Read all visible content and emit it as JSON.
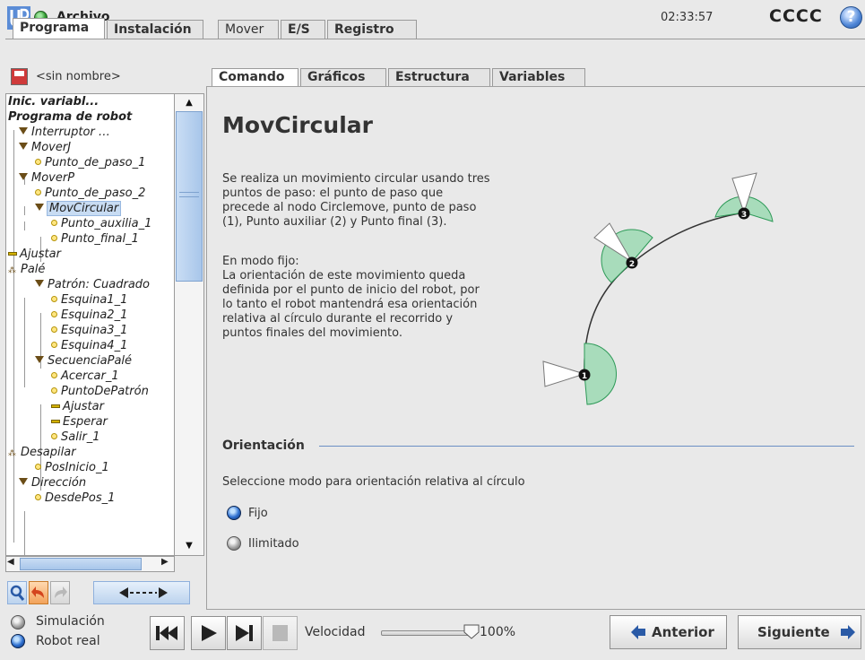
{
  "header": {
    "file_menu": "Archivo",
    "clock": "02:33:57",
    "robot_name": "CCCC",
    "help_glyph": "?"
  },
  "main_tabs": [
    "Programa",
    "Instalación",
    "Mover",
    "E/S",
    "Registro"
  ],
  "program": {
    "name": "<sin nombre>",
    "tree": [
      {
        "label": "Inic. variabl...",
        "kind": "text",
        "bold": true
      },
      {
        "label": "Programa de robot",
        "kind": "text",
        "bold": true
      },
      {
        "label": "Interruptor …",
        "kind": "block"
      },
      {
        "label": "MoverJ",
        "kind": "block"
      },
      {
        "label": "Punto_de_paso_1",
        "kind": "waypoint"
      },
      {
        "label": "MoverP",
        "kind": "block"
      },
      {
        "label": "Punto_de_paso_2",
        "kind": "waypoint"
      },
      {
        "label": "MovCircular",
        "kind": "block",
        "selected": true
      },
      {
        "label": "Punto_auxilia_1",
        "kind": "waypoint"
      },
      {
        "label": "Punto_final_1",
        "kind": "waypoint"
      },
      {
        "label": "Ajustar",
        "kind": "bar"
      },
      {
        "label": "Palé",
        "kind": "pallet"
      },
      {
        "label": "Patrón: Cuadrado",
        "kind": "block"
      },
      {
        "label": "Esquina1_1",
        "kind": "waypoint"
      },
      {
        "label": "Esquina2_1",
        "kind": "waypoint"
      },
      {
        "label": "Esquina3_1",
        "kind": "waypoint"
      },
      {
        "label": "Esquina4_1",
        "kind": "waypoint"
      },
      {
        "label": "SecuenciaPalé",
        "kind": "block"
      },
      {
        "label": "Acercar_1",
        "kind": "waypoint"
      },
      {
        "label": "PuntoDePatrón",
        "kind": "waypoint"
      },
      {
        "label": "Ajustar",
        "kind": "bar"
      },
      {
        "label": "Esperar",
        "kind": "bar"
      },
      {
        "label": "Salir_1",
        "kind": "waypoint"
      },
      {
        "label": "Desapilar",
        "kind": "pallet"
      },
      {
        "label": "PosInicio_1",
        "kind": "waypoint"
      },
      {
        "label": "Dirección",
        "kind": "block"
      },
      {
        "label": "DesdePos_1",
        "kind": "waypoint"
      }
    ]
  },
  "sub_tabs": [
    "Comando",
    "Gráficos",
    "Estructura",
    "Variables"
  ],
  "command": {
    "title": "MovCircular",
    "description_1": "Se realiza un movimiento circular usando tres\npuntos de paso: el punto de paso que\nprecede al nodo Circlemove, punto de paso\n(1), Punto auxiliar (2) y Punto final (3).",
    "description_2": "En modo fijo:\nLa orientación de este movimiento queda\ndefinida por el punto de inicio del robot, por\nlo tanto el robot mantendrá esa orientación\nrelativa al círculo durante el recorrido y\npuntos finales del movimiento.",
    "diagram_points": [
      "1",
      "2",
      "3"
    ],
    "orientation_heading": "Orientación",
    "orientation_instruction": "Seleccione modo para orientación relativa al círculo",
    "orientation_options": [
      {
        "label": "Fijo",
        "selected": true
      },
      {
        "label": "Ilimitado",
        "selected": false
      }
    ]
  },
  "footer": {
    "modes": [
      {
        "label": "Simulación",
        "selected": false
      },
      {
        "label": "Robot real",
        "selected": true
      }
    ],
    "speed_label": "Velocidad",
    "speed_value": "100%",
    "speed_fraction": 1.0,
    "prev_label": "Anterior",
    "next_label": "Siguiente"
  },
  "colors": {
    "accent": "#6b8fc4",
    "selection": "#c8dcf3",
    "waypoint": "#ffe681",
    "diagram_sector": "#a8dcbb"
  }
}
